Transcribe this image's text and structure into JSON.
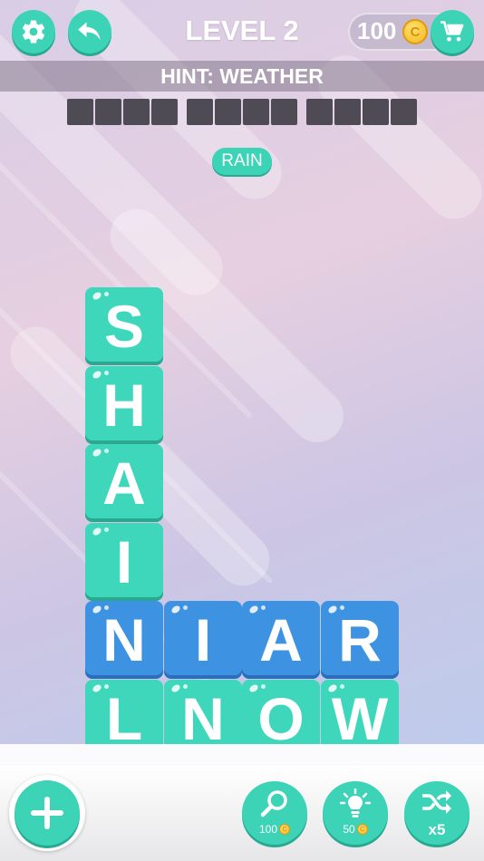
{
  "header": {
    "level_title": "LEVEL 2",
    "coins": "100",
    "coin_symbol": "C"
  },
  "hint": {
    "text": "HINT: WEATHER"
  },
  "answer_slots": {
    "words": [
      4,
      4,
      4
    ]
  },
  "found_words": [
    {
      "word": "RAIN"
    }
  ],
  "grid": {
    "rows": [
      [
        {
          "letter": "S",
          "color": "teal"
        },
        null,
        null,
        null
      ],
      [
        {
          "letter": "H",
          "color": "teal"
        },
        null,
        null,
        null
      ],
      [
        {
          "letter": "A",
          "color": "teal"
        },
        null,
        null,
        null
      ],
      [
        {
          "letter": "I",
          "color": "teal"
        },
        null,
        null,
        null
      ],
      [
        {
          "letter": "N",
          "color": "blue"
        },
        {
          "letter": "I",
          "color": "blue"
        },
        {
          "letter": "A",
          "color": "blue"
        },
        {
          "letter": "R",
          "color": "blue"
        }
      ],
      [
        {
          "letter": "L",
          "color": "teal"
        },
        {
          "letter": "N",
          "color": "teal"
        },
        {
          "letter": "O",
          "color": "teal"
        },
        {
          "letter": "W",
          "color": "teal"
        }
      ]
    ]
  },
  "powerups": {
    "magnifier_cost": "100",
    "hint_cost": "50",
    "shuffle_count": "x5"
  },
  "colors": {
    "accent": "#3cd3b7",
    "tile_teal": "#3fd7bb",
    "tile_blue": "#3d93e2",
    "coin": "#f6b81a"
  },
  "icons": {
    "settings": "gear-icon",
    "back": "undo-arrow-icon",
    "shop": "shopping-cart-icon",
    "add": "plus-icon",
    "magnifier": "magnifier-icon",
    "hint": "lightbulb-icon",
    "shuffle": "shuffle-icon"
  }
}
